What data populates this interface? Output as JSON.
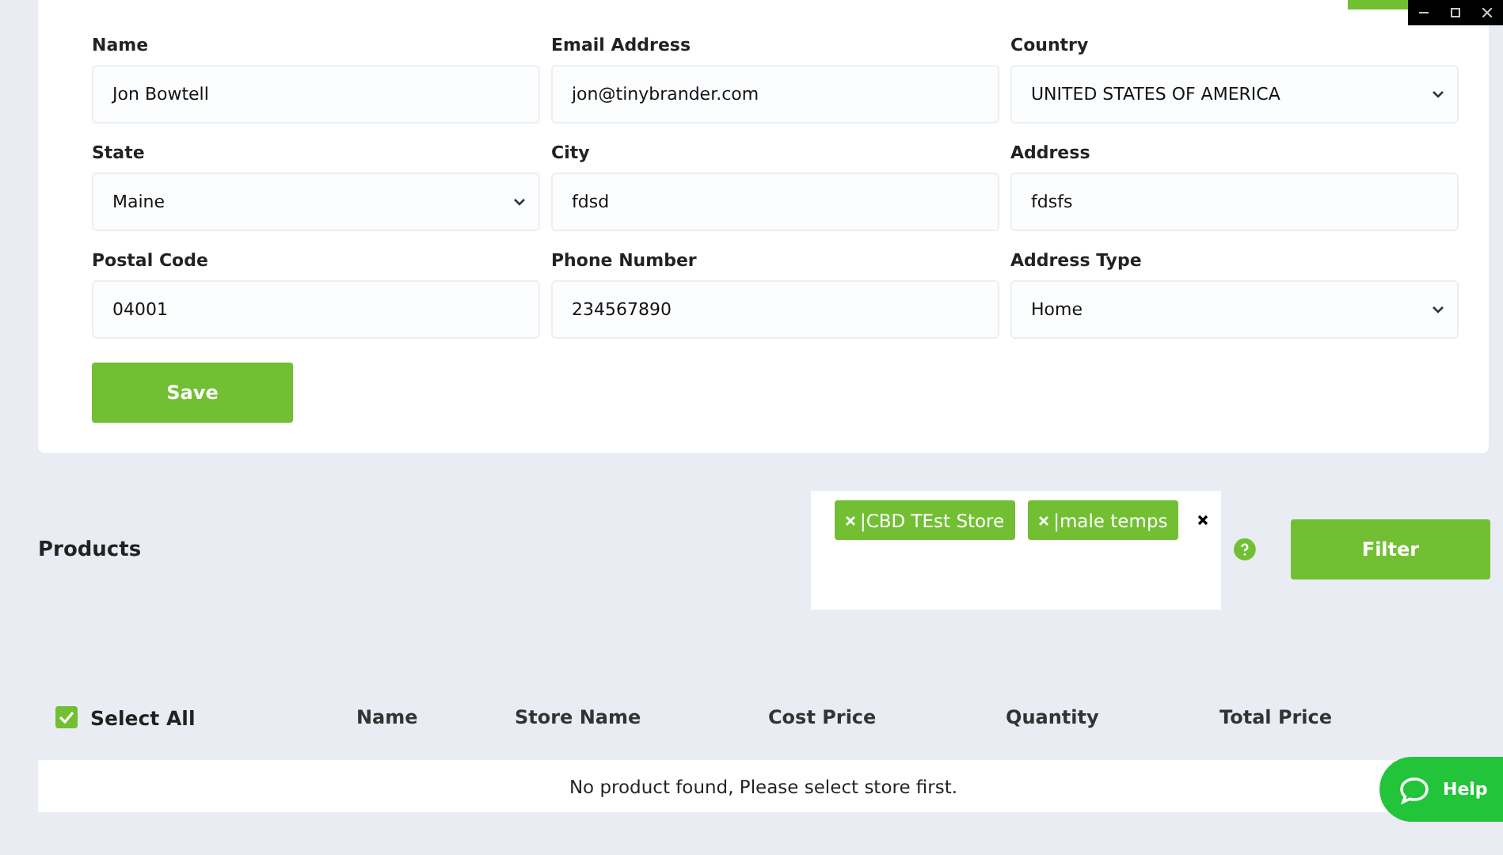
{
  "form": {
    "fields": [
      {
        "label": "Name",
        "value": "Jon Bowtell",
        "kind": "text"
      },
      {
        "label": "Email Address",
        "value": "jon@tinybrander.com",
        "kind": "text"
      },
      {
        "label": "Country",
        "value": "UNITED STATES OF AMERICA",
        "kind": "select"
      },
      {
        "label": "State",
        "value": "Maine",
        "kind": "select"
      },
      {
        "label": "City",
        "value": "fdsd",
        "kind": "text"
      },
      {
        "label": "Address",
        "value": "fdsfs",
        "kind": "text"
      },
      {
        "label": "Postal Code",
        "value": "04001",
        "kind": "text"
      },
      {
        "label": "Phone Number",
        "value": "234567890",
        "kind": "text"
      },
      {
        "label": "Address Type",
        "value": "Home",
        "kind": "select"
      }
    ],
    "save_button": "Save"
  },
  "products": {
    "title": "Products",
    "stores": [
      {
        "label": "|CBD TEst Store"
      },
      {
        "label": "|male temps"
      }
    ],
    "filter_button": "Filter"
  },
  "table": {
    "select_all": {
      "label": "Select All",
      "checked": true
    },
    "columns": [
      "Name",
      "Store Name",
      "Cost Price",
      "Quantity",
      "Total Price"
    ],
    "empty_message": "No product found, Please select store first."
  },
  "help_button": "Help"
}
